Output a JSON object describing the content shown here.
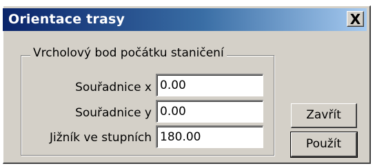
{
  "window": {
    "title": "Orientace trasy",
    "close_label": "X"
  },
  "group": {
    "label": "Vrcholový bod počátku staničení"
  },
  "fields": [
    {
      "label": "Souřadnice x",
      "value": "0.00"
    },
    {
      "label": "Souřadnice y",
      "value": "0.00"
    },
    {
      "label": "Jižník ve stupních",
      "value": "180.00"
    }
  ],
  "buttons": {
    "close": "Zavřít",
    "apply": "Použít"
  }
}
